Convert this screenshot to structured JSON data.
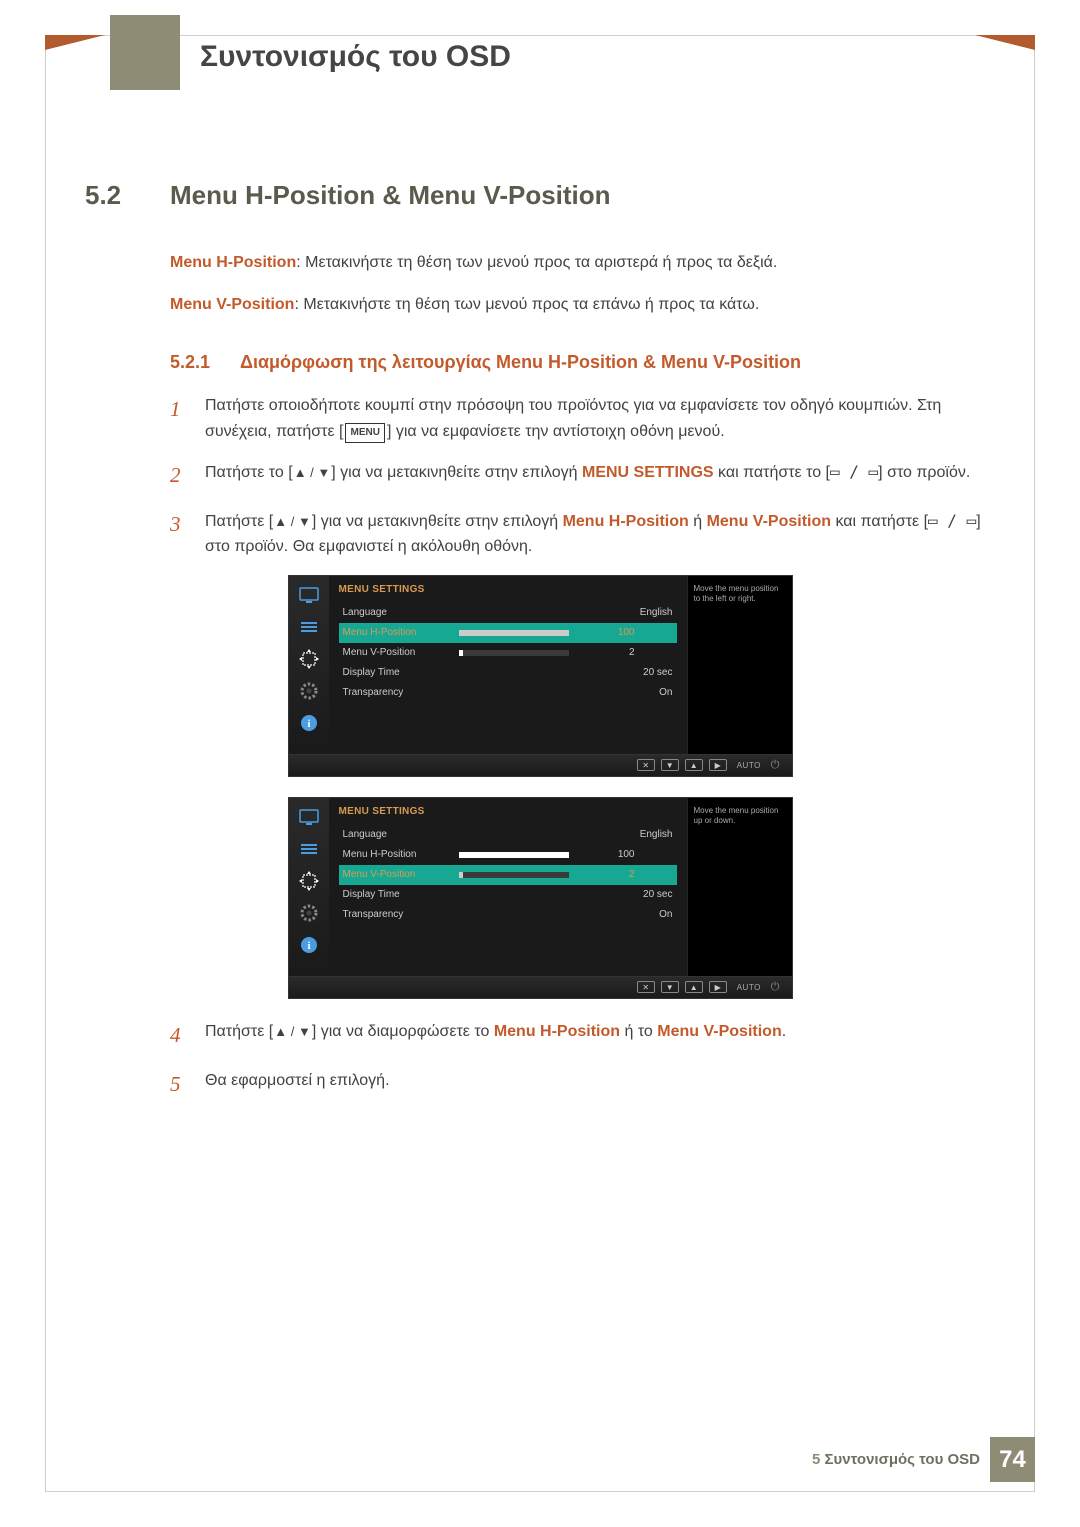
{
  "chapter_title": "Συντονισμός του OSD",
  "section": {
    "num": "5.2",
    "title": "Menu H-Position & Menu V-Position"
  },
  "desc1_label": "Menu H-Position",
  "desc1_text": ": Μετακινήστε τη θέση των μενού προς τα αριστερά ή προς τα δεξιά.",
  "desc2_label": "Menu V-Position",
  "desc2_text": ": Μετακινήστε τη θέση των μενού προς τα επάνω ή προς τα κάτω.",
  "subsection": {
    "num": "5.2.1",
    "title": "Διαμόρφωση της λειτουργίας Menu H-Position & Menu V-Position"
  },
  "steps": {
    "s1_num": "1",
    "s1a": "Πατήστε οποιοδήποτε κουμπί στην πρόσοψη του προϊόντος για να εμφανίσετε τον οδηγό κουμπιών. Στη συνέχεια, πατήστε [",
    "s1_menu": "MENU",
    "s1b": "] για να εμφανίσετε την αντίστοιχη οθόνη μενού.",
    "s2_num": "2",
    "s2a": "Πατήστε το [",
    "s2_keys": "▲ / ▼",
    "s2b": "] για να μετακινηθείτε στην επιλογή ",
    "s2_hl": "MENU SETTINGS",
    "s2c": " και πατήστε το [",
    "s2_keys2": "▭ / ▭",
    "s2d": "] στο προϊόν.",
    "s3_num": "3",
    "s3a": "Πατήστε [",
    "s3_keys": "▲ / ▼",
    "s3b": "] για να μετακινηθείτε στην επιλογή ",
    "s3_hl1": "Menu H-Position",
    "s3_or": " ή ",
    "s3_hl2": "Menu V-Position",
    "s3c": " και πατήστε [",
    "s3_keys2": "▭ / ▭",
    "s3d": "] στο προϊόν. Θα εμφανιστεί η ακόλουθη οθόνη.",
    "s4_num": "4",
    "s4a": "Πατήστε [",
    "s4_keys": "▲ / ▼",
    "s4b": "] για να διαμορφώσετε το ",
    "s4_hl1": "Menu H-Position",
    "s4_or": " ή το ",
    "s4_hl2": "Menu V-Position",
    "s4c": ".",
    "s5_num": "5",
    "s5": "Θα εφαρμοστεί η επιλογή."
  },
  "osd": {
    "title": "MENU SETTINGS",
    "rows": {
      "lang_label": "Language",
      "lang_val": "English",
      "hpos_label": "Menu H-Position",
      "hpos_val": "100",
      "vpos_label": "Menu V-Position",
      "vpos_val": "2",
      "disp_label": "Display Time",
      "disp_val": "20 sec",
      "tran_label": "Transparency",
      "tran_val": "On"
    },
    "help1": "Move the menu position to the left or right.",
    "help2": "Move the menu position up or down.",
    "auto": "AUTO"
  },
  "footer": {
    "chapter_num": "5",
    "text": " Συντονισμός του OSD",
    "page": "74"
  }
}
